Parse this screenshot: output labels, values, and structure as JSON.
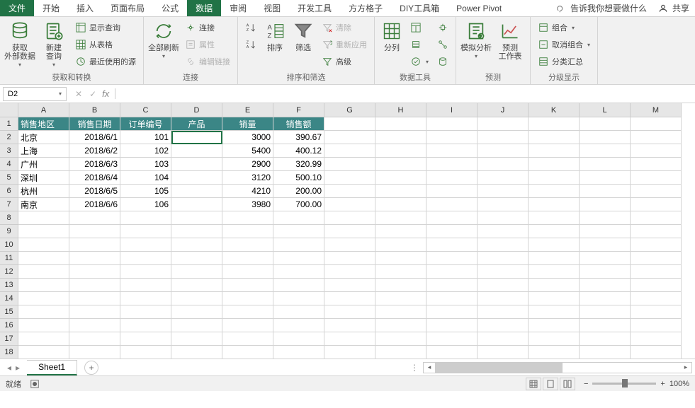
{
  "tabs": {
    "file": "文件",
    "items": [
      "开始",
      "插入",
      "页面布局",
      "公式",
      "数据",
      "审阅",
      "视图",
      "开发工具",
      "方方格子",
      "DIY工具箱",
      "Power Pivot"
    ],
    "active_index": 4,
    "tell_me": "告诉我你想要做什么",
    "share": "共享"
  },
  "ribbon": {
    "g1": {
      "label": "获取和转换",
      "btn1": "获取\n外部数据",
      "btn2": "新建\n查询",
      "s1": "显示查询",
      "s2": "从表格",
      "s3": "最近使用的源"
    },
    "g2": {
      "label": "连接",
      "btn1": "全部刷新",
      "s1": "连接",
      "s2": "属性",
      "s3": "编辑链接"
    },
    "g3": {
      "label": "排序和筛选",
      "btn1": "排序",
      "btn1b": "筛选",
      "s1": "清除",
      "s2": "重新应用",
      "s3": "高级"
    },
    "g4": {
      "label": "数据工具",
      "btn1": "分列"
    },
    "g5": {
      "label": "预测",
      "btn1": "模拟分析",
      "btn2": "预测\n工作表"
    },
    "g6": {
      "label": "分级显示",
      "s1": "组合",
      "s2": "取消组合",
      "s3": "分类汇总"
    }
  },
  "formula_bar": {
    "name_box": "D2",
    "formula": ""
  },
  "grid": {
    "columns": [
      "A",
      "B",
      "C",
      "D",
      "E",
      "F",
      "G",
      "H",
      "I",
      "J",
      "K",
      "L",
      "M"
    ],
    "row_count": 18,
    "headers": [
      "销售地区",
      "销售日期",
      "订单编号",
      "产品",
      "销量",
      "销售额"
    ],
    "data": [
      {
        "region": "北京",
        "date": "2018/6/1",
        "order": "101",
        "product": "",
        "qty": "3000",
        "amount": "390.67"
      },
      {
        "region": "上海",
        "date": "2018/6/2",
        "order": "102",
        "product": "",
        "qty": "5400",
        "amount": "400.12"
      },
      {
        "region": "广州",
        "date": "2018/6/3",
        "order": "103",
        "product": "",
        "qty": "2900",
        "amount": "320.99"
      },
      {
        "region": "深圳",
        "date": "2018/6/4",
        "order": "104",
        "product": "",
        "qty": "3120",
        "amount": "500.10"
      },
      {
        "region": "杭州",
        "date": "2018/6/5",
        "order": "105",
        "product": "",
        "qty": "4210",
        "amount": "200.00"
      },
      {
        "region": "南京",
        "date": "2018/6/6",
        "order": "106",
        "product": "",
        "qty": "3980",
        "amount": "700.00"
      }
    ],
    "active_cell": "D2"
  },
  "sheets": {
    "tabs": [
      "Sheet1"
    ],
    "active_index": 0
  },
  "status": {
    "mode": "就绪",
    "zoom": "100%"
  }
}
